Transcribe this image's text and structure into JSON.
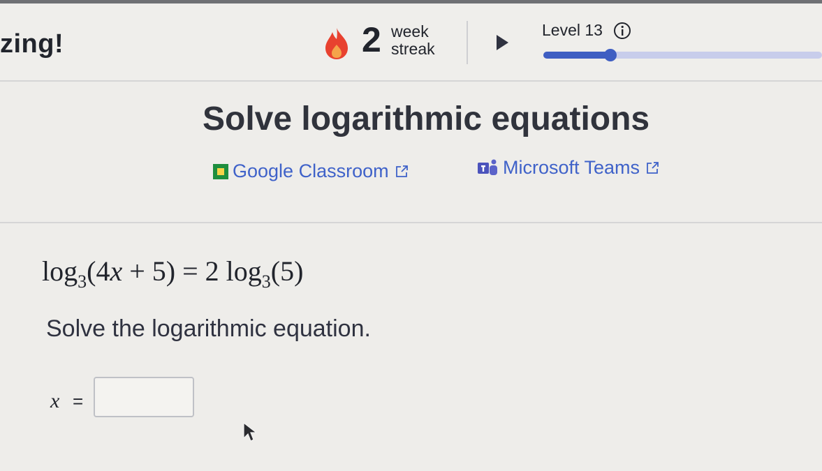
{
  "header": {
    "greeting": "zing!",
    "streak": {
      "count": "2",
      "unit_line1": "week",
      "unit_line2": "streak"
    },
    "level": {
      "label": "Level 13",
      "progress": 0.24
    }
  },
  "exercise": {
    "title": "Solve logarithmic equations",
    "share": {
      "google_classroom": "Google Classroom",
      "microsoft_teams": "Microsoft Teams"
    },
    "equation": {
      "lhs_fn": "log",
      "lhs_base": "3",
      "lhs_open": "(4",
      "lhs_var": "x",
      "lhs_rest": " + 5)",
      "equals": " = ",
      "rhs_coef": "2 ",
      "rhs_fn": "log",
      "rhs_base": "3",
      "rhs_arg": "(5)"
    },
    "prompt": "Solve the logarithmic equation.",
    "answer": {
      "variable": "x",
      "equals": "=",
      "value": ""
    }
  },
  "colors": {
    "accent": "#3f5ec2",
    "link": "#3f62c9",
    "flame": "#e8412f"
  }
}
